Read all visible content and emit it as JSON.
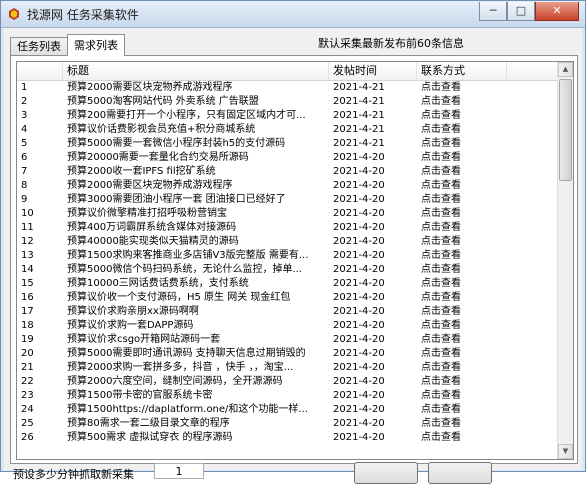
{
  "window": {
    "title": "找源网 任务采集软件",
    "controls": [
      "─",
      "□",
      "✕"
    ]
  },
  "tabs": [
    {
      "label": "任务列表",
      "active": false
    },
    {
      "label": "需求列表",
      "active": true
    }
  ],
  "header_info": "默认采集最新发布前60条信息",
  "table": {
    "columns": [
      "",
      "标题",
      "发帖时间",
      "联系方式"
    ],
    "rows": [
      {
        "no": "1",
        "title": "预算2000需要区块宠物养成游戏程序",
        "date": "2021-4-21",
        "contact": "点击查看"
      },
      {
        "no": "2",
        "title": "预算5000淘客网站代码 外卖系统 广告联盟",
        "date": "2021-4-21",
        "contact": "点击查看"
      },
      {
        "no": "3",
        "title": "预算200需要打开一个小程序，只有固定区域内才可...",
        "date": "2021-4-21",
        "contact": "点击查看"
      },
      {
        "no": "4",
        "title": "预算议价话费影视会员充值+积分商城系统",
        "date": "2021-4-21",
        "contact": "点击查看"
      },
      {
        "no": "5",
        "title": "预算5000需要一套微信小程序封装h5的支付源码",
        "date": "2021-4-21",
        "contact": "点击查看"
      },
      {
        "no": "6",
        "title": "预算20000需要一套量化合约交易所源码",
        "date": "2021-4-20",
        "contact": "点击查看"
      },
      {
        "no": "7",
        "title": "预算2000收一套IPFS fil挖矿系统",
        "date": "2021-4-20",
        "contact": "点击查看"
      },
      {
        "no": "8",
        "title": "预算2000需要区块宠物养成游戏程序",
        "date": "2021-4-20",
        "contact": "点击查看"
      },
      {
        "no": "9",
        "title": "预算3000需要团油小程序一套 团油接口已经好了",
        "date": "2021-4-20",
        "contact": "点击查看"
      },
      {
        "no": "10",
        "title": "预算议价微擎精准打招呼吸粉营销宝",
        "date": "2021-4-20",
        "contact": "点击查看"
      },
      {
        "no": "11",
        "title": "预算400万词霸屏系统含媒体对接源码",
        "date": "2021-4-20",
        "contact": "点击查看"
      },
      {
        "no": "12",
        "title": "预算40000能实现类似天猫精灵的源码",
        "date": "2021-4-20",
        "contact": "点击查看"
      },
      {
        "no": "13",
        "title": "预算1500求购来客推商业多店铺V3版完整版 需要有...",
        "date": "2021-4-20",
        "contact": "点击查看"
      },
      {
        "no": "14",
        "title": "预算5000微信个码扫码系统，无论什么监控，掉单...",
        "date": "2021-4-20",
        "contact": "点击查看"
      },
      {
        "no": "15",
        "title": "预算10000三网话费话费系统，支付系统",
        "date": "2021-4-20",
        "contact": "点击查看"
      },
      {
        "no": "16",
        "title": "预算议价收一个支付源码，H5 原生 网关 现金红包",
        "date": "2021-4-20",
        "contact": "点击查看"
      },
      {
        "no": "17",
        "title": "预算议价求购亲朋xx源码啊啊",
        "date": "2021-4-20",
        "contact": "点击查看"
      },
      {
        "no": "18",
        "title": "预算议价求购一套DAPP源码",
        "date": "2021-4-20",
        "contact": "点击查看"
      },
      {
        "no": "19",
        "title": "预算议价求csgo开箱网站源码一套",
        "date": "2021-4-20",
        "contact": "点击查看"
      },
      {
        "no": "20",
        "title": "预算5000需要即时通讯源码 支持聊天信息过期销毁的",
        "date": "2021-4-20",
        "contact": "点击查看"
      },
      {
        "no": "21",
        "title": "预算2000求购一套拼多多，抖音 ，快手 ，，淘宝...",
        "date": "2021-4-20",
        "contact": "点击查看"
      },
      {
        "no": "22",
        "title": "预算2000六度空间，缝制空间源码，全开源源码",
        "date": "2021-4-20",
        "contact": "点击查看"
      },
      {
        "no": "23",
        "title": "预算1500带卡密的官服系统卡密",
        "date": "2021-4-20",
        "contact": "点击查看"
      },
      {
        "no": "24",
        "title": "预算1500https://daplatform.one/和这个功能一样...",
        "date": "2021-4-20",
        "contact": "点击查看"
      },
      {
        "no": "25",
        "title": "预算80需求一套二级目录文章的程序",
        "date": "2021-4-20",
        "contact": "点击查看"
      },
      {
        "no": "26",
        "title": "预算500需求 虚拟试穿衣 的程序源码",
        "date": "2021-4-20",
        "contact": "点击查看"
      }
    ]
  },
  "bottom": {
    "label": "预设多少分钟抓取新采集",
    "input_value": "1",
    "buttons": [
      "",
      ""
    ]
  }
}
